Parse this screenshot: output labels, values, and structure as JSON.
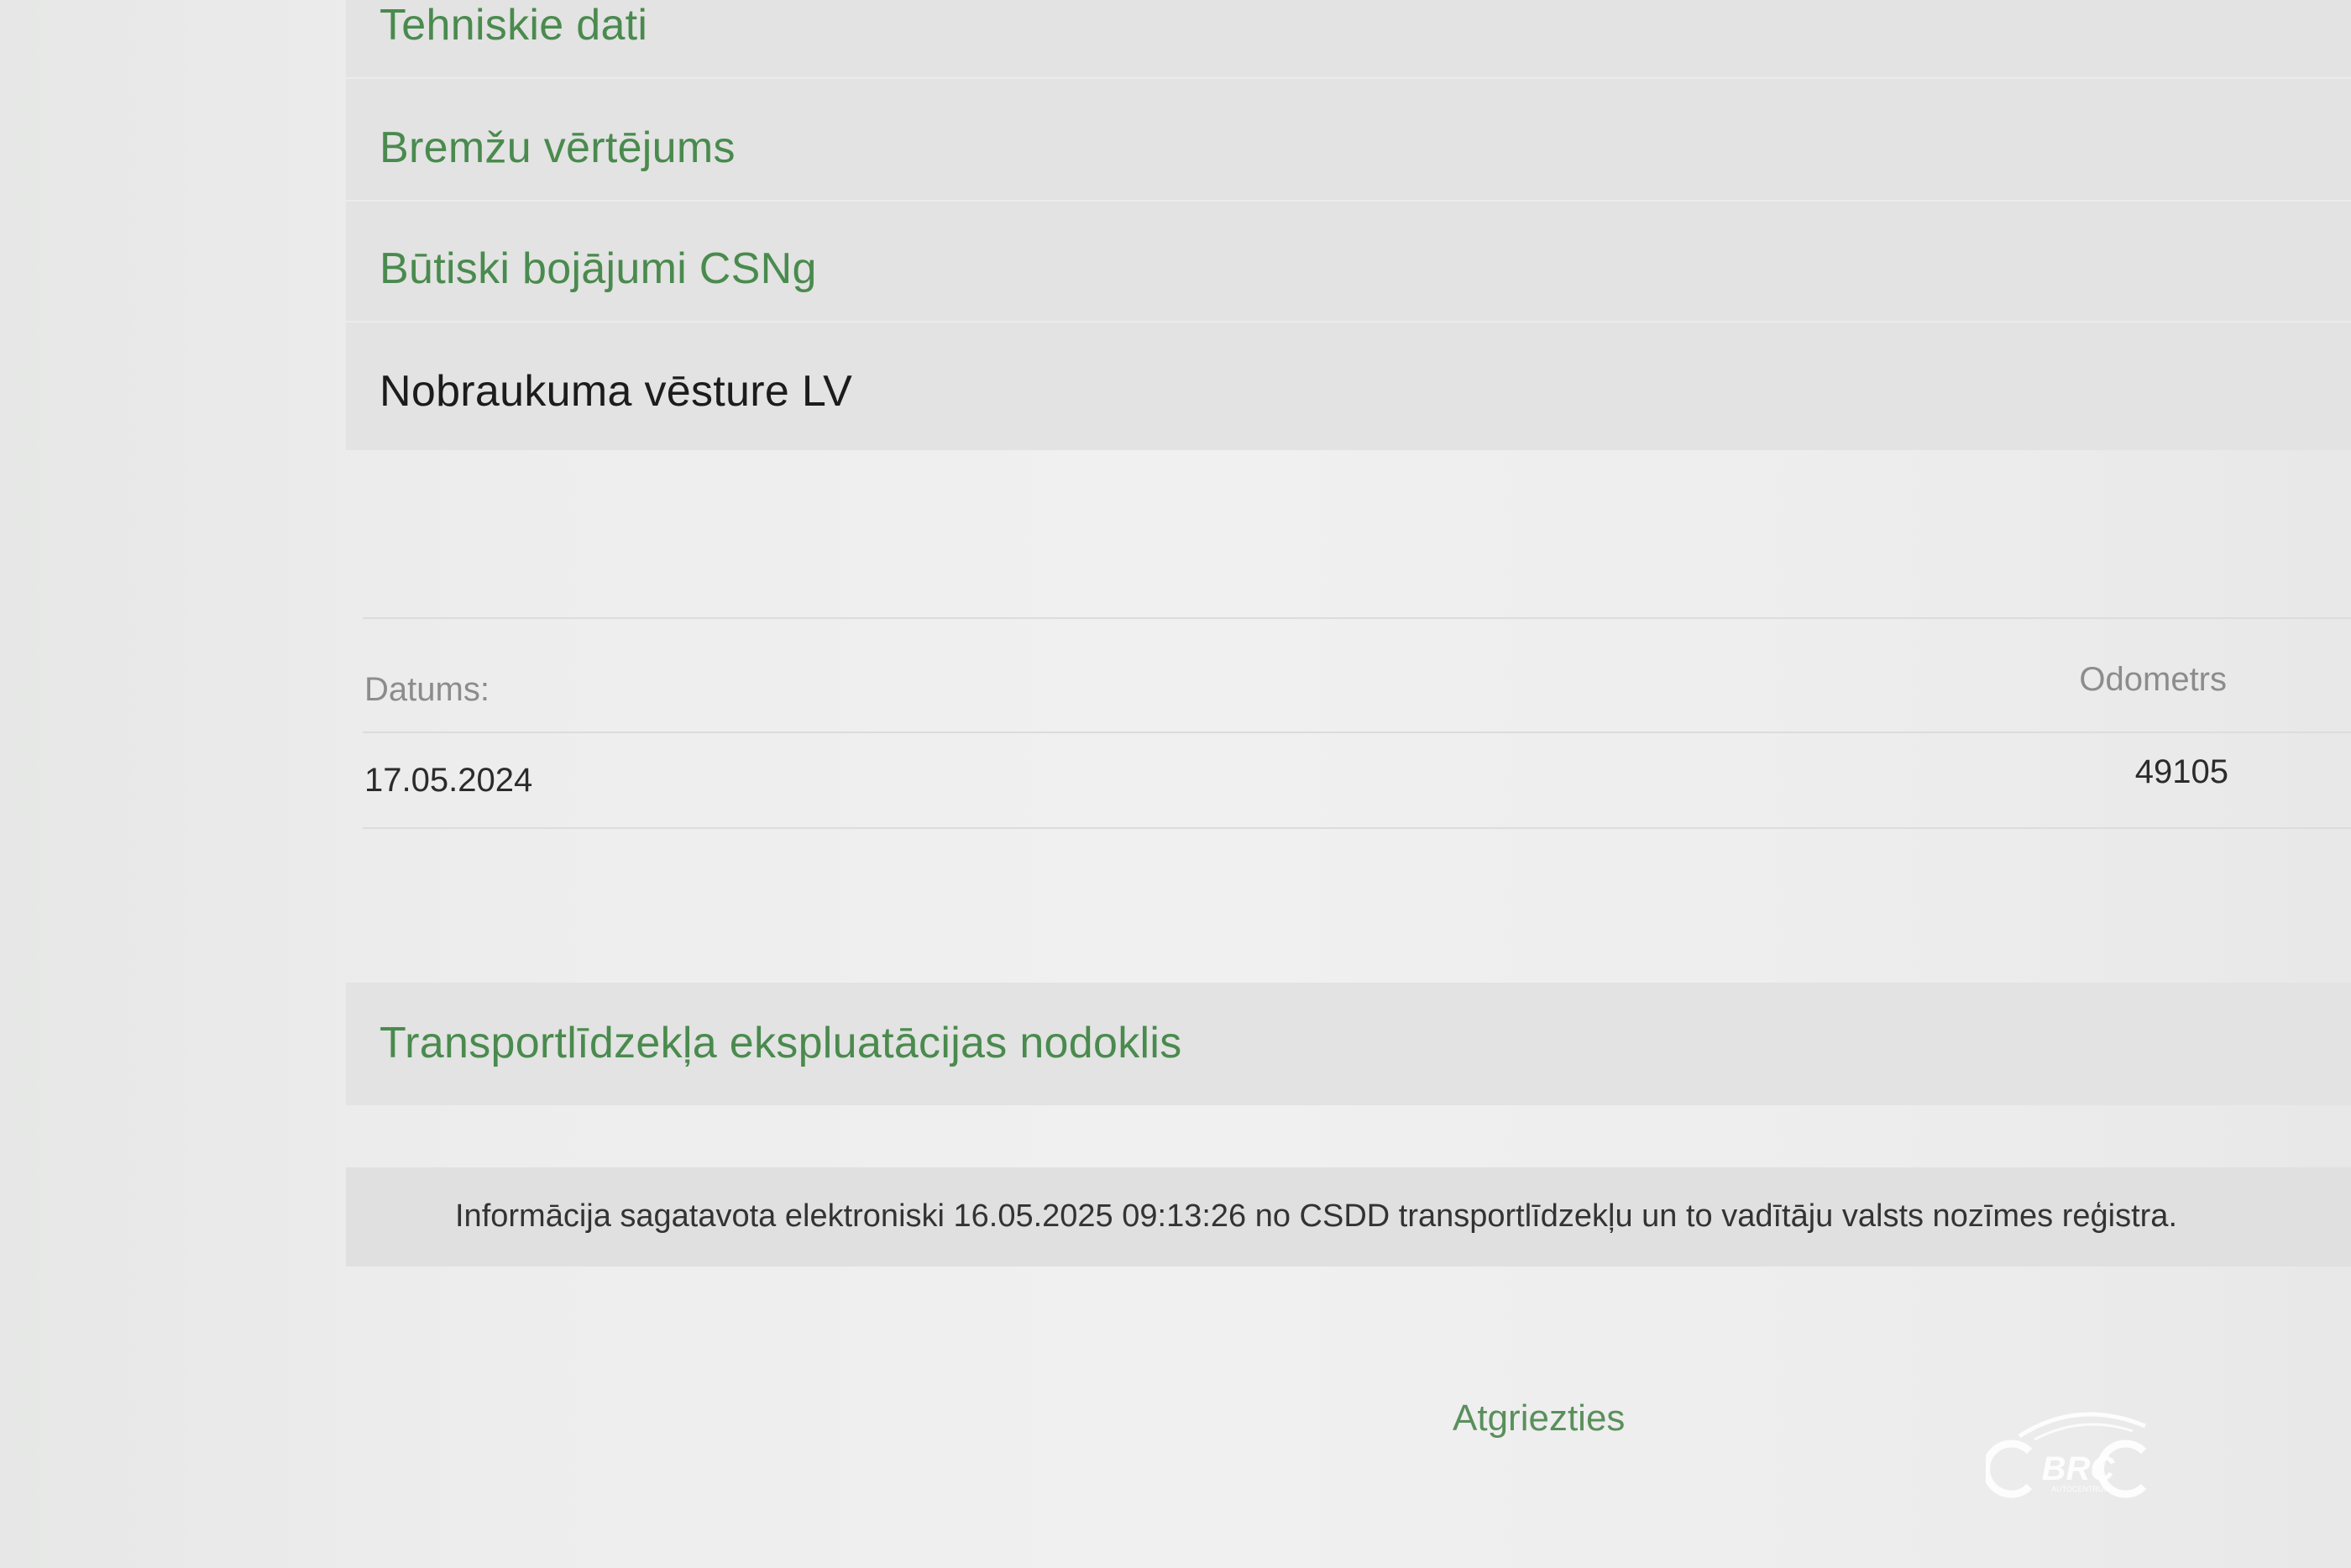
{
  "menu": {
    "items": [
      {
        "label": "Tehniskie dati",
        "active": false
      },
      {
        "label": "Bremžu vērtējums",
        "active": false
      },
      {
        "label": "Būtiski bojājumi CSNg",
        "active": false
      },
      {
        "label": "Nobraukuma vēsture LV",
        "active": true
      }
    ]
  },
  "mileage_history": {
    "columns": {
      "date": "Datums:",
      "odometer": "Odometrs"
    },
    "rows": [
      {
        "date": "17.05.2024",
        "odometer": "49105"
      }
    ]
  },
  "tax_section": {
    "label": "Transportlīdzekļa ekspluatācijas nodoklis"
  },
  "info": {
    "text": "Informācija sagatavota elektroniski 16.05.2025 09:13:26 no CSDD transportlīdzekļu un to vadītāju valsts nozīmes reģistra."
  },
  "back_link": {
    "label": "Atgriezties"
  },
  "watermark": {
    "text": "BRC",
    "subtext": "AUTOCENTRUM"
  },
  "colors": {
    "link_green": "#4a8a4e",
    "active_text": "#1c1c1c",
    "panel_bg": "#e2e3e2"
  }
}
